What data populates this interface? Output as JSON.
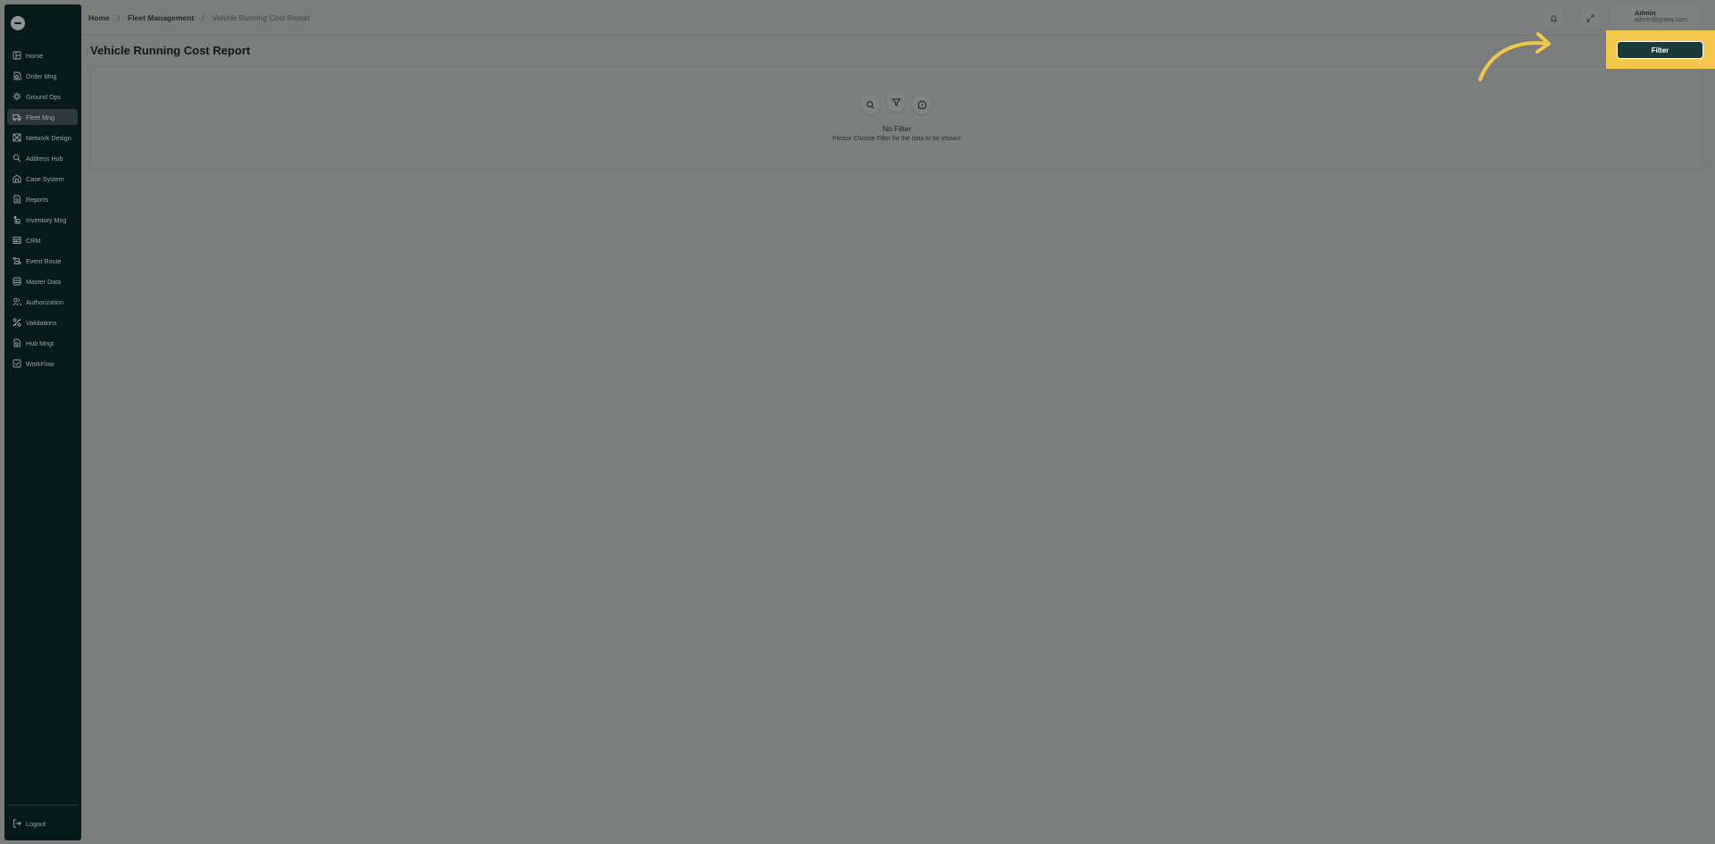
{
  "sidebar": {
    "items": [
      {
        "label": "Home",
        "icon": "layout-icon"
      },
      {
        "label": "Order Mng",
        "icon": "order-icon"
      },
      {
        "label": "Ground Ops",
        "icon": "ground-ops-icon"
      },
      {
        "label": "Fleet Mng",
        "icon": "truck-icon",
        "active": true
      },
      {
        "label": "Network Design",
        "icon": "network-icon"
      },
      {
        "label": "Address Hub",
        "icon": "address-icon"
      },
      {
        "label": "Case System",
        "icon": "case-icon"
      },
      {
        "label": "Reports",
        "icon": "report-icon"
      },
      {
        "label": "Inventory Mng",
        "icon": "inventory-icon"
      },
      {
        "label": "CRM",
        "icon": "crm-icon"
      },
      {
        "label": "Event Route",
        "icon": "route-icon"
      },
      {
        "label": "Master Data",
        "icon": "database-icon"
      },
      {
        "label": "Authorization",
        "icon": "users-icon"
      },
      {
        "label": "Validations",
        "icon": "validation-icon"
      },
      {
        "label": "Hub Mngt",
        "icon": "hub-icon"
      },
      {
        "label": "WorkFlow",
        "icon": "workflow-icon"
      }
    ],
    "logout_label": "Logout"
  },
  "breadcrumb": {
    "home": "Home",
    "fleet": "Fleet Management",
    "current": "Vehicle Running Cost Report",
    "separator": "/"
  },
  "user": {
    "name": "Admin",
    "email": "admin@gnteq.com"
  },
  "page": {
    "title": "Vehicle Running Cost Report",
    "filter_label": "Filter"
  },
  "empty_state": {
    "title": "No Filter",
    "subtitle": "Please Choose Filter for the data to be shown!"
  },
  "colors": {
    "sidebar_bg": "#071a1b",
    "highlight": "#f3c84a",
    "filter_button": "#1b3a3a",
    "overlay_bg": "#7b7d7c"
  }
}
